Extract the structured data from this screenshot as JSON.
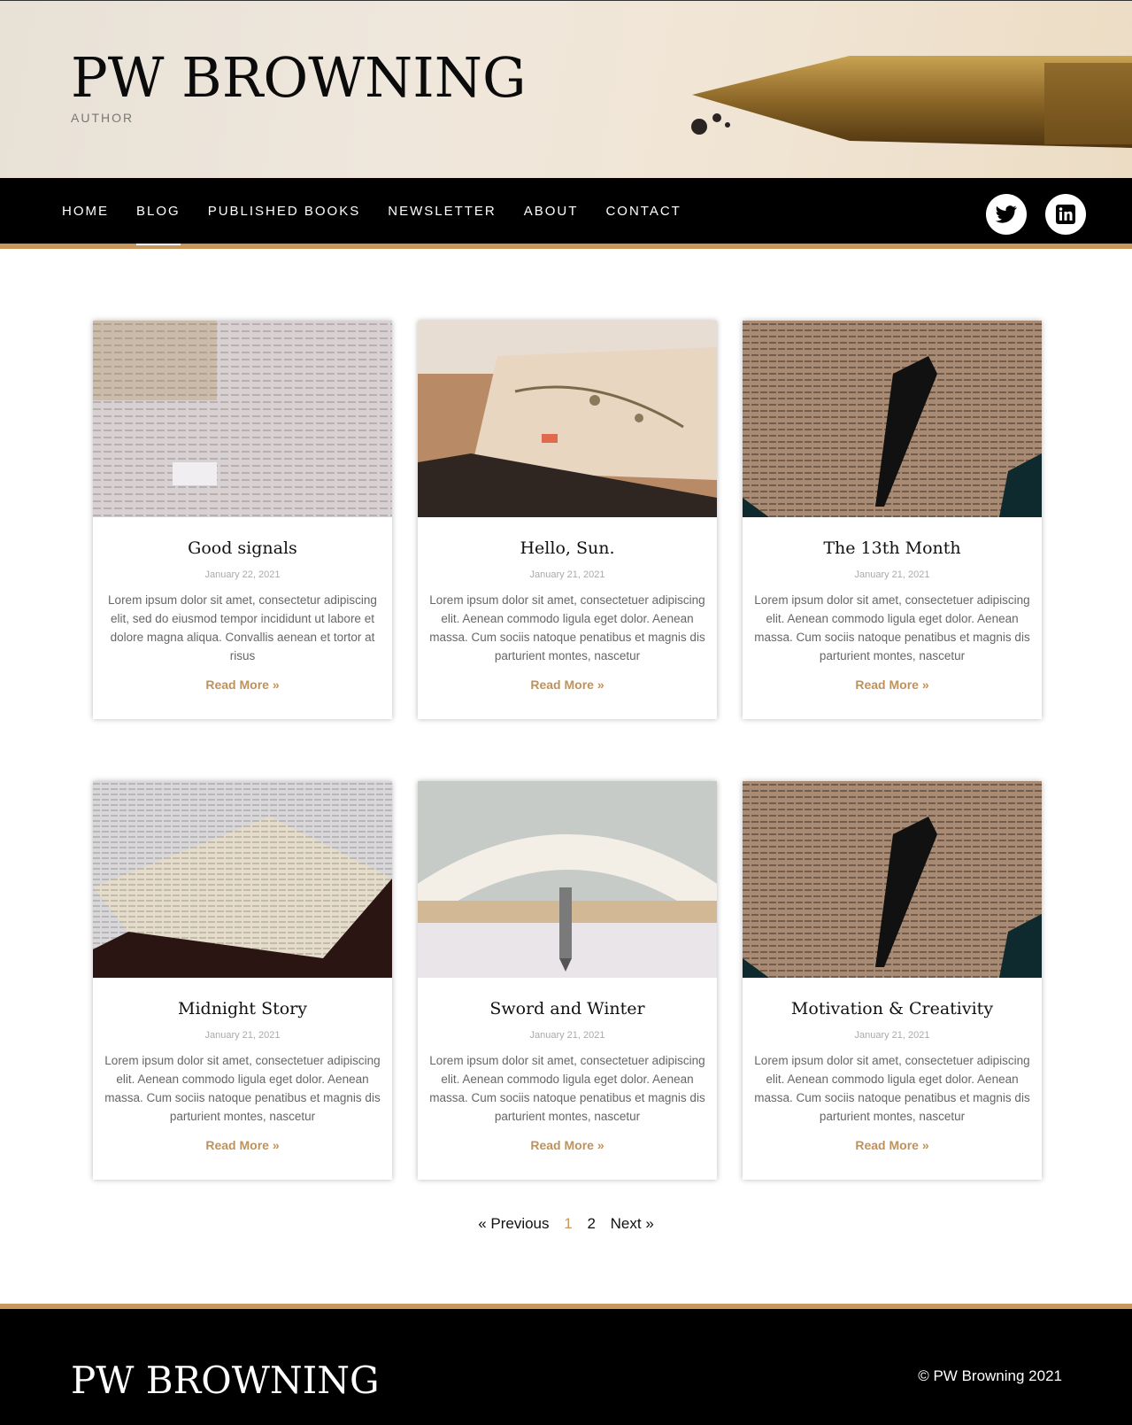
{
  "header": {
    "title": "PW BROWNING",
    "subtitle": "AUTHOR"
  },
  "nav": {
    "items": [
      {
        "label": "HOME",
        "active": false
      },
      {
        "label": "BLOG",
        "active": true
      },
      {
        "label": "PUBLISHED BOOKS",
        "active": false
      },
      {
        "label": "NEWSLETTER",
        "active": false
      },
      {
        "label": "ABOUT",
        "active": false
      },
      {
        "label": "CONTACT",
        "active": false
      }
    ],
    "social": [
      {
        "icon": "twitter-icon"
      },
      {
        "icon": "linkedin-icon"
      }
    ]
  },
  "posts": [
    {
      "title": "Good signals",
      "date": "January 22, 2021",
      "excerpt": "Lorem ipsum dolor sit amet, consectetur adipiscing elit, sed do eiusmod tempor incididunt ut labore et dolore magna aliqua. Convallis aenean et tortor at risus",
      "read_more": "Read More »",
      "image": "paper-texture-image"
    },
    {
      "title": "Hello, Sun.",
      "date": "January 21, 2021",
      "excerpt": "Lorem ipsum dolor sit amet, consectetuer adipiscing elit. Aenean commodo ligula eget dolor. Aenean massa. Cum sociis natoque penatibus et magnis dis parturient montes, nascetur",
      "read_more": "Read More »",
      "image": "book-flowers-image"
    },
    {
      "title": "The 13th Month",
      "date": "January 21, 2021",
      "excerpt": "Lorem ipsum dolor sit amet, consectetuer adipiscing elit. Aenean commodo ligula eget dolor. Aenean massa. Cum sociis natoque penatibus et magnis dis parturient montes, nascetur",
      "read_more": "Read More »",
      "image": "book-pen-image"
    },
    {
      "title": "Midnight Story",
      "date": "January 21, 2021",
      "excerpt": "Lorem ipsum dolor sit amet, consectetuer adipiscing elit. Aenean commodo ligula eget dolor. Aenean massa. Cum sociis natoque penatibus et magnis dis parturient montes, nascetur",
      "read_more": "Read More »",
      "image": "old-book-image"
    },
    {
      "title": "Sword and Winter",
      "date": "January 21, 2021",
      "excerpt": "Lorem ipsum dolor sit amet, consectetuer adipiscing elit. Aenean commodo ligula eget dolor. Aenean massa. Cum sociis natoque penatibus et magnis dis parturient montes, nascetur",
      "read_more": "Read More »",
      "image": "book-fan-pen-image"
    },
    {
      "title": "Motivation & Creativity",
      "date": "January 21, 2021",
      "excerpt": "Lorem ipsum dolor sit amet, consectetuer adipiscing elit. Aenean commodo ligula eget dolor. Aenean massa. Cum sociis natoque penatibus et magnis dis parturient montes, nascetur",
      "read_more": "Read More »",
      "image": "book-pen-image"
    }
  ],
  "pagination": {
    "previous": "« Previous",
    "pages": [
      "1",
      "2"
    ],
    "current": "1",
    "next": "Next »"
  },
  "footer": {
    "title": "PW BROWNING",
    "copyright": "© PW Browning 2021"
  },
  "colors": {
    "accent": "#c8975c",
    "nav_bg": "#000000",
    "read_more": "#c0925a"
  }
}
